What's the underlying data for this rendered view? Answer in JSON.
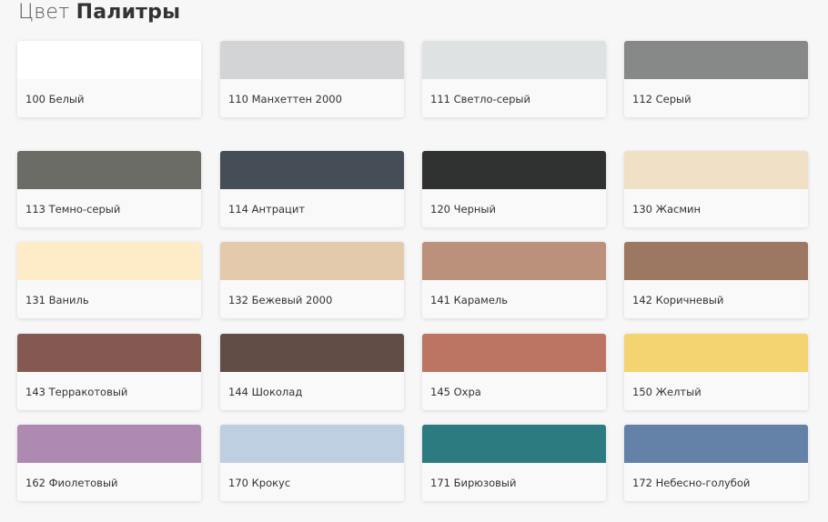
{
  "header": {
    "title_light": "Цвет",
    "title_bold": "Палитры"
  },
  "colors": [
    {
      "label": "100 Белый",
      "hex": "#ffffff"
    },
    {
      "label": "110 Манхеттен 2000",
      "hex": "#d3d4d6"
    },
    {
      "label": "111 Светло-серый",
      "hex": "#dfe2e3"
    },
    {
      "label": "112 Серый",
      "hex": "#868988"
    },
    {
      "label": "113 Темно-серый",
      "hex": "#6a6c65"
    },
    {
      "label": "114 Антрацит",
      "hex": "#454d56"
    },
    {
      "label": "120 Черный",
      "hex": "#303131"
    },
    {
      "label": "130 Жасмин",
      "hex": "#f0e0c6"
    },
    {
      "label": "131 Ваниль",
      "hex": "#fdecc7"
    },
    {
      "label": "132 Бежевый 2000",
      "hex": "#e3caad"
    },
    {
      "label": "141 Карамель",
      "hex": "#bc917b"
    },
    {
      "label": "142 Коричневый",
      "hex": "#9c7762"
    },
    {
      "label": "143 Терракотовый",
      "hex": "#845951"
    },
    {
      "label": "144 Шоколад",
      "hex": "#624d46"
    },
    {
      "label": "145 Охра",
      "hex": "#bc7563"
    },
    {
      "label": "150 Желтый",
      "hex": "#f3d470"
    },
    {
      "label": "162 Фиолетовый",
      "hex": "#ae8ab0"
    },
    {
      "label": "170 Крокус",
      "hex": "#bdcfe0"
    },
    {
      "label": "171 Бирюзовый",
      "hex": "#2c7b80"
    },
    {
      "label": "172 Небесно-голубой",
      "hex": "#6481a8"
    }
  ]
}
